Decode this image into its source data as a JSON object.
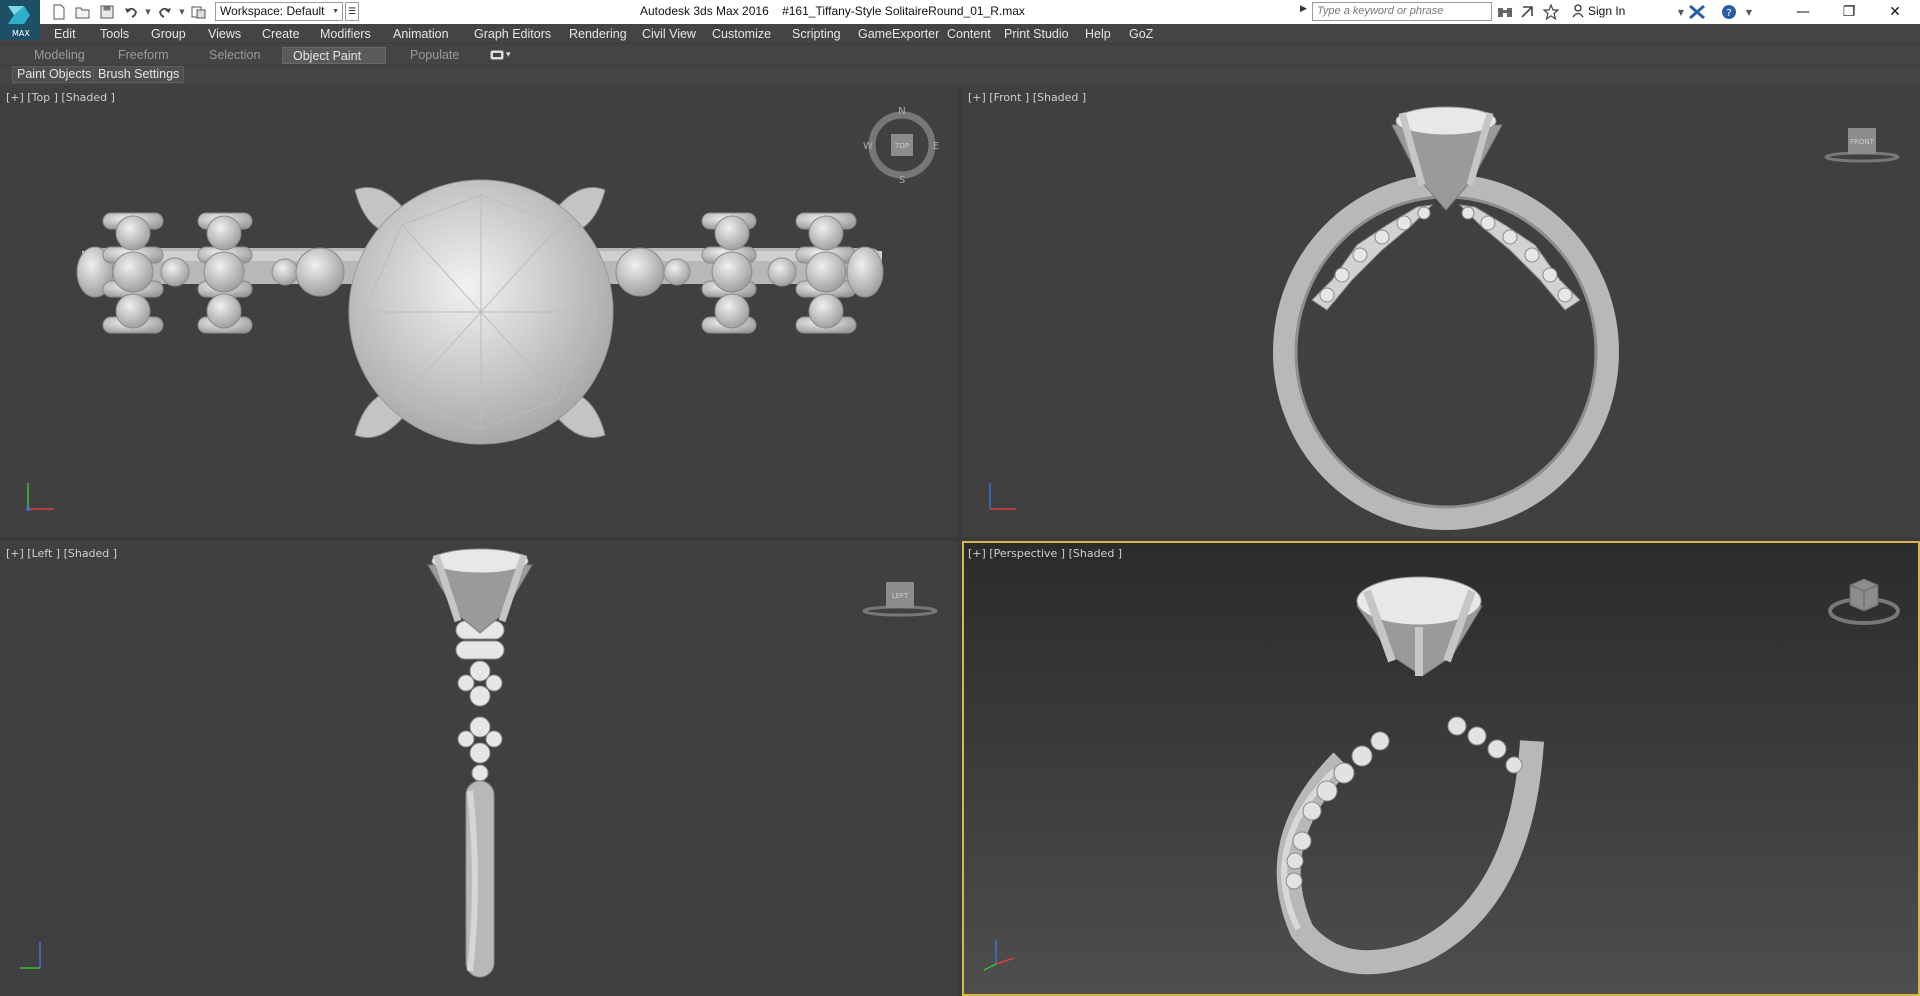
{
  "app": {
    "logo_text": "MAX",
    "title": "Autodesk 3ds Max 2016    #161_Tiffany-Style SolitaireRound_01_R.max",
    "workspace_label": "Workspace: Default",
    "search_placeholder": "Type a keyword or phrase",
    "signin_label": "Sign In"
  },
  "quick_access": [
    "new-icon",
    "open-icon",
    "save-icon",
    "undo-icon",
    "redo-icon",
    "project-folder-icon"
  ],
  "menu": [
    "Edit",
    "Tools",
    "Group",
    "Views",
    "Create",
    "Modifiers",
    "Animation",
    "Graph Editors",
    "Rendering",
    "Civil View",
    "Customize",
    "Scripting",
    "GameExporter",
    "Content",
    "Print Studio",
    "Help",
    "GoZ"
  ],
  "ribbon": {
    "tabs": [
      "Modeling",
      "Freeform",
      "Selection",
      "Object Paint",
      "Populate"
    ],
    "active_tab": "Object Paint",
    "sub_buttons": [
      "Paint Objects",
      "Brush Settings"
    ]
  },
  "viewports": {
    "top": {
      "label": "[+] [Top ] [Shaded ]",
      "cube": "TOP",
      "compass": [
        "N",
        "E",
        "S",
        "W"
      ]
    },
    "front": {
      "label": "[+] [Front ] [Shaded ]",
      "cube": "FRONT"
    },
    "left": {
      "label": "[+] [Left ] [Shaded ]",
      "cube": "LEFT"
    },
    "perspective": {
      "label": "[+] [Perspective ] [Shaded ]",
      "active": true
    }
  },
  "colors": {
    "ui_bg": "#444444",
    "viewport_bg": "#404040",
    "active_viewport_border": "#d7b74a",
    "model": "#d0d0d0"
  }
}
